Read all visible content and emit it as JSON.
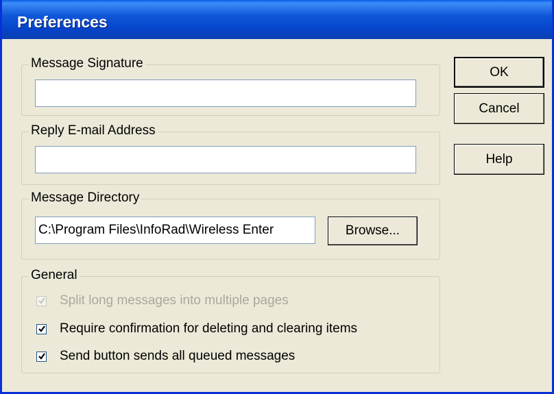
{
  "window": {
    "title": "Preferences"
  },
  "buttons": {
    "ok": "OK",
    "cancel": "Cancel",
    "help": "Help",
    "browse": "Browse..."
  },
  "groups": {
    "signature": {
      "label": "Message Signature",
      "value": ""
    },
    "reply": {
      "label": "Reply E-mail Address",
      "value": ""
    },
    "directory": {
      "label": "Message Directory",
      "value": "C:\\Program Files\\InfoRad\\Wireless Enter"
    },
    "general": {
      "label": "General",
      "options": [
        {
          "label": "Split long messages into multiple pages",
          "checked": true,
          "enabled": false
        },
        {
          "label": "Require confirmation for deleting and clearing items",
          "checked": true,
          "enabled": true
        },
        {
          "label": "Send button sends all queued messages",
          "checked": true,
          "enabled": true
        }
      ]
    }
  }
}
